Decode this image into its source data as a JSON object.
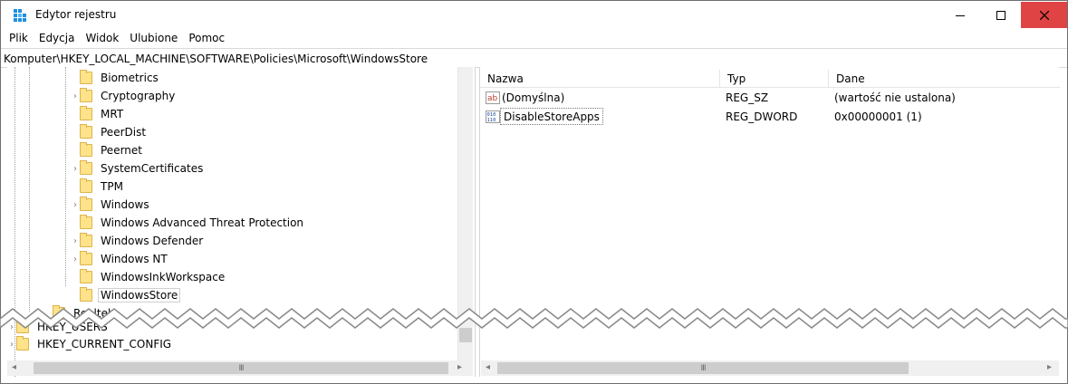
{
  "window": {
    "title": "Edytor rejestru",
    "buttons": {
      "minimize": "minimize-icon",
      "maximize": "maximize-icon",
      "close": "close-icon"
    },
    "close_color": "#e04343"
  },
  "menu": [
    "Plik",
    "Edycja",
    "Widok",
    "Ulubione",
    "Pomoc"
  ],
  "address": "Komputer\\HKEY_LOCAL_MACHINE\\SOFTWARE\\Policies\\Microsoft\\WindowsStore",
  "tree": {
    "items": [
      {
        "label": "Biometrics",
        "expandable": false
      },
      {
        "label": "Cryptography",
        "expandable": true
      },
      {
        "label": "MRT",
        "expandable": false
      },
      {
        "label": "PeerDist",
        "expandable": false
      },
      {
        "label": "Peernet",
        "expandable": false
      },
      {
        "label": "SystemCertificates",
        "expandable": true
      },
      {
        "label": "TPM",
        "expandable": false
      },
      {
        "label": "Windows",
        "expandable": true
      },
      {
        "label": "Windows Advanced Threat Protection",
        "expandable": false
      },
      {
        "label": "Windows Defender",
        "expandable": true
      },
      {
        "label": "Windows NT",
        "expandable": true
      },
      {
        "label": "WindowsInkWorkspace",
        "expandable": false
      },
      {
        "label": "WindowsStore",
        "expandable": false,
        "selected": true
      }
    ],
    "partial_items": [
      "Realtek",
      "HKEY_USERS"
    ],
    "root_items": [
      "HKEY_CURRENT_CONFIG"
    ]
  },
  "values": {
    "columns": [
      "Nazwa",
      "Typ",
      "Dane"
    ],
    "rows": [
      {
        "name": "(Domyślna)",
        "type": "REG_SZ",
        "data": "(wartość nie ustalona)",
        "icon": "string-value-icon"
      },
      {
        "name": "DisableStoreApps",
        "type": "REG_DWORD",
        "data": "0x00000001 (1)",
        "icon": "binary-value-icon"
      }
    ]
  },
  "scroll_thumb_grip": "III"
}
